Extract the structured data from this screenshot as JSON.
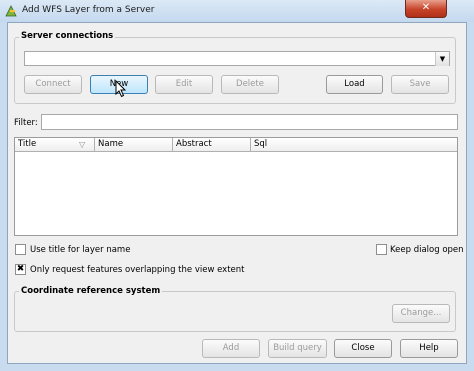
{
  "window": {
    "title": "Add WFS Layer from a Server",
    "close_symbol": "✕"
  },
  "server_connections": {
    "group_title": "Server connections",
    "selected": "",
    "buttons": {
      "connect": "Connect",
      "new": "New",
      "edit": "Edit",
      "delete": "Delete",
      "load": "Load",
      "save": "Save"
    }
  },
  "filter": {
    "label": "Filter:",
    "value": ""
  },
  "layers_table": {
    "columns": [
      "Title",
      "Name",
      "Abstract",
      "Sql"
    ],
    "rows": []
  },
  "options": {
    "use_title": {
      "label": "Use title for layer name",
      "checked": false
    },
    "keep_open": {
      "label": "Keep dialog open",
      "checked": false
    },
    "only_request": {
      "label": "Only request features overlapping the view extent",
      "checked": true,
      "mark": "✖"
    }
  },
  "crs": {
    "group_title": "Coordinate reference system",
    "change_label": "Change..."
  },
  "footer": {
    "add": "Add",
    "build_query": "Build query",
    "close": "Close",
    "help": "Help"
  }
}
